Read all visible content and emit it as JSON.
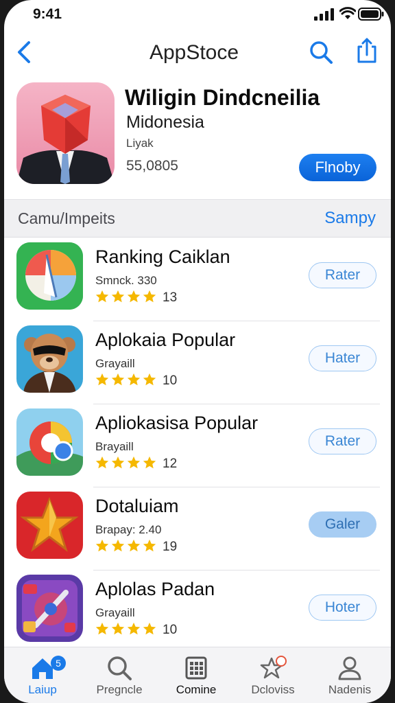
{
  "status_bar": {
    "time": "9:41"
  },
  "nav": {
    "title": "AppStoce"
  },
  "featured": {
    "title": "Wiligin Dindcneilia",
    "subtitle": "Midonesia",
    "developer": "Liyak",
    "count": "55,0805",
    "button_label": "Flnoby"
  },
  "section": {
    "title": "Camu/Impeits",
    "link_label": "Sampy"
  },
  "apps": [
    {
      "name": "Ranking Caiklan",
      "meta": "Smnck. 330",
      "stars": 4,
      "rating": "13",
      "button_label": "Rater",
      "button_style": "outline"
    },
    {
      "name": "Aplokaia Popular",
      "meta": "Grayaill",
      "stars": 4,
      "rating": "10",
      "button_label": "Hater",
      "button_style": "outline"
    },
    {
      "name": "Apliokasisa Popular",
      "meta": "Brayaill",
      "stars": 4,
      "rating": "12",
      "button_label": "Rater",
      "button_style": "outline"
    },
    {
      "name": "Dotaluiam",
      "meta": "Brapay: 2.40",
      "stars": 4,
      "rating": "19",
      "button_label": "Galer",
      "button_style": "filled"
    },
    {
      "name": "Aplolas Padan",
      "meta": "Grayaill",
      "stars": 4,
      "rating": "10",
      "button_label": "Hoter",
      "button_style": "outline"
    }
  ],
  "tabbar": {
    "tabs": [
      {
        "label": "Laiup",
        "icon": "home-icon",
        "badge": "5",
        "active": true
      },
      {
        "label": "Pregncle",
        "icon": "search-icon",
        "active": false
      },
      {
        "label": "Comine",
        "icon": "grid-icon",
        "active": false
      },
      {
        "label": "Dcloviss",
        "icon": "star-icon",
        "active": false
      },
      {
        "label": "Nadenis",
        "icon": "person-icon",
        "active": false
      }
    ]
  },
  "colors": {
    "accent": "#1a7ae8",
    "star": "#f5b800"
  }
}
